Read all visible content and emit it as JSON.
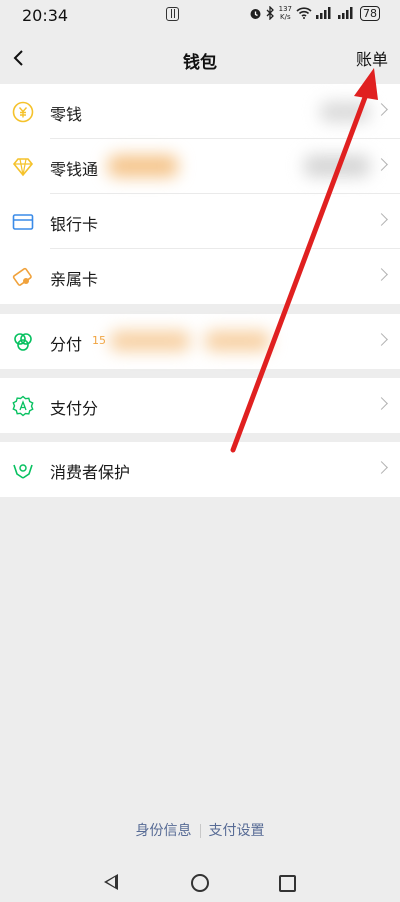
{
  "status_bar": {
    "time": "20:34",
    "speed_value": "137",
    "speed_unit": "K/s",
    "battery": "78"
  },
  "header": {
    "title": "钱包",
    "bill_label": "账单"
  },
  "wallet_items": [
    {
      "label": "零钱",
      "icon": "yuan-coin-icon"
    },
    {
      "label": "零钱通",
      "icon": "diamond-icon"
    },
    {
      "label": "银行卡",
      "icon": "bank-card-icon"
    },
    {
      "label": "亲属卡",
      "icon": "family-card-icon"
    }
  ],
  "installment": {
    "label": "分付",
    "badge": "15",
    "icon": "installment-icon"
  },
  "pay_score": {
    "label": "支付分",
    "icon": "pay-score-icon"
  },
  "consumer_protection": {
    "label": "消费者保护",
    "icon": "hands-protect-icon"
  },
  "footer": {
    "identity": "身份信息",
    "settings": "支付设置"
  },
  "colors": {
    "accent_yellow": "#f5c22b",
    "accent_blue": "#3a8be8",
    "accent_green": "#07c160",
    "link": "#576b95",
    "annotation_red": "#e02020"
  }
}
